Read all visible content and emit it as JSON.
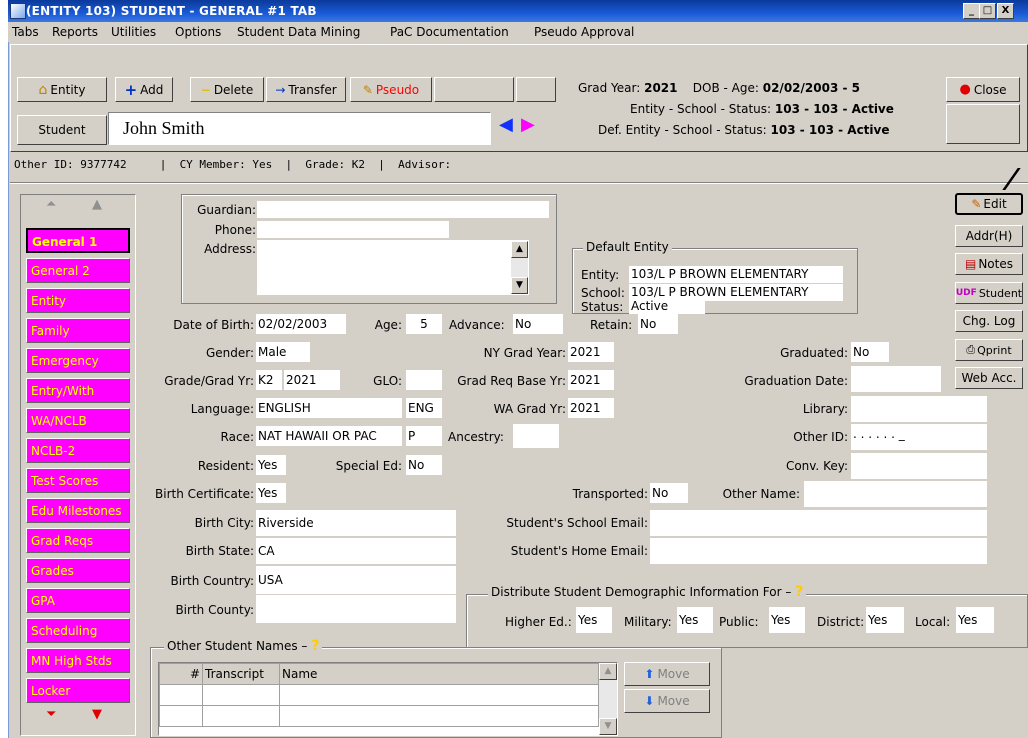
{
  "window": {
    "title": "(ENTITY 103) STUDENT - GENERAL #1 TAB",
    "minimize": "_",
    "maximize": "□",
    "close": "X"
  },
  "menu": [
    "Tabs",
    "Reports",
    "Utilities",
    "Options",
    "Student Data Mining",
    "PaC Documentation",
    "Pseudo Approval"
  ],
  "toolbar": {
    "entity": "Entity",
    "add": "Add",
    "delete": "Delete",
    "transfer": "Transfer",
    "pseudo": "Pseudo",
    "close": "Close",
    "student": "Student",
    "student_name": "John Smith"
  },
  "header": {
    "grad_year_label": "Grad Year:",
    "grad_year": "2021",
    "dob_age_label": "DOB - Age:",
    "dob_age": "02/02/2003 - 5",
    "ess_label": "Entity - School - Status:",
    "ess_value": "103 - 103 - Active",
    "def_ess_label": "Def. Entity - School - Status:",
    "def_ess_value": "103 - 103 - Active"
  },
  "infobar": "Other ID: 9377742     |  CY Member: Yes  |  Grade: K2  |  Advisor:",
  "nav": {
    "items": [
      "General 1",
      "General 2",
      "Entity",
      "Family",
      "Emergency",
      "Entry/With",
      "WA/NCLB",
      "NCLB-2",
      "Test Scores",
      "Edu Milestones",
      "Grad Reqs",
      "Grades",
      "GPA",
      "Scheduling",
      "MN High Stds",
      "Locker"
    ],
    "active": "General 1"
  },
  "right_buttons": {
    "edit": "Edit",
    "addr": "Addr(H)",
    "notes": "Notes",
    "udf": "Student",
    "udf_prefix": "UDF",
    "chg_log": "Chg. Log",
    "qprint": "Qprint",
    "web_acc": "Web Acc."
  },
  "guardian": {
    "guardian_label": "Guardian:",
    "phone_label": "Phone:",
    "address_label": "Address:"
  },
  "default_entity": {
    "title": "Default Entity",
    "entity_label": "Entity:",
    "entity": "103/L P BROWN ELEMENTARY",
    "school_label": "School:",
    "school": "103/L P BROWN ELEMENTARY",
    "status_label": "Status:",
    "status": "Active"
  },
  "fields": {
    "dob_label": "Date of Birth:",
    "dob": "02/02/2003",
    "age_label": "Age:",
    "age": "5",
    "advance_label": "Advance:",
    "advance": "No",
    "retain_label": "Retain:",
    "retain": "No",
    "gender_label": "Gender:",
    "gender": "Male",
    "ny_grad_label": "NY Grad Year:",
    "ny_grad": "2021",
    "graduated_label": "Graduated:",
    "graduated": "No",
    "grade_label": "Grade/Grad Yr:",
    "grade": "K2",
    "grad_yr": "2021",
    "glo_label": "GLO:",
    "grad_req_label": "Grad Req Base Yr:",
    "grad_req": "2021",
    "grad_date_label": "Graduation Date:",
    "language_label": "Language:",
    "language": "ENGLISH",
    "language_code": "ENG",
    "wa_grad_label": "WA Grad Yr:",
    "wa_grad": "2021",
    "library_label": "Library:",
    "race_label": "Race:",
    "race": "NAT HAWAII OR PAC",
    "race_code": "P",
    "ancestry_label": "Ancestry:",
    "other_id_label": "Other ID:",
    "other_id": ". . . . .  . _",
    "resident_label": "Resident:",
    "resident": "Yes",
    "special_ed_label": "Special Ed:",
    "special_ed": "No",
    "conv_key_label": "Conv. Key:",
    "birth_cert_label": "Birth Certificate:",
    "birth_cert": "Yes",
    "transported_label": "Transported:",
    "transported": "No",
    "other_name_label": "Other Name:",
    "birth_city_label": "Birth City:",
    "birth_city": "Riverside",
    "school_email_label": "Student's School Email:",
    "birth_state_label": "Birth State:",
    "birth_state": "CA",
    "home_email_label": "Student's Home Email:",
    "birth_country_label": "Birth Country:",
    "birth_country": "USA",
    "birth_county_label": "Birth County:"
  },
  "distribute": {
    "title": "Distribute Student Demographic Information For",
    "help": "?",
    "higher_ed_label": "Higher Ed.:",
    "higher_ed": "Yes",
    "military_label": "Military:",
    "military": "Yes",
    "public_label": "Public:",
    "public": "Yes",
    "district_label": "District:",
    "district": "Yes",
    "local_label": "Local:",
    "local": "Yes"
  },
  "other_names": {
    "title": "Other Student Names",
    "help": "?",
    "columns": [
      "#",
      "Transcript",
      "Name"
    ],
    "move_up": "Move",
    "move_down": "Move"
  }
}
